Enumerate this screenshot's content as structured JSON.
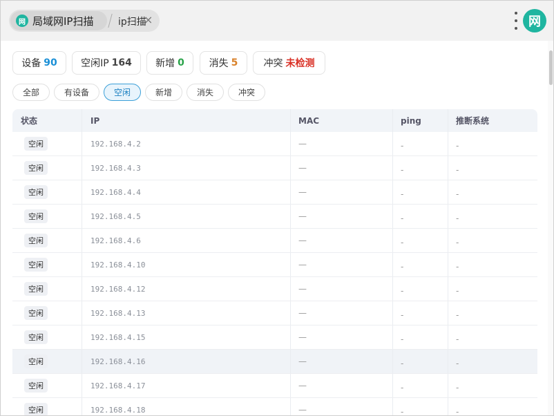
{
  "tabbar": {
    "app_logo_glyph": "网",
    "app_title": "局域网IP扫描",
    "page_tab": "ip扫描",
    "close_glyph": "×"
  },
  "avatar_glyph": "网",
  "stats": [
    {
      "label": "设备",
      "value": "90",
      "color": "#1a8fd6"
    },
    {
      "label": "空闲IP",
      "value": "164",
      "color": "#444444"
    },
    {
      "label": "新增",
      "value": "0",
      "color": "#2aa34a"
    },
    {
      "label": "消失",
      "value": "5",
      "color": "#d9822b"
    },
    {
      "label": "冲突",
      "value": "未检测",
      "color": "#d93025"
    }
  ],
  "filters": [
    {
      "label": "全部",
      "active": false
    },
    {
      "label": "有设备",
      "active": false
    },
    {
      "label": "空闲",
      "active": true
    },
    {
      "label": "新增",
      "active": false
    },
    {
      "label": "消失",
      "active": false
    },
    {
      "label": "冲突",
      "active": false
    }
  ],
  "table": {
    "columns": [
      "状态",
      "IP",
      "MAC",
      "ping",
      "推断系统"
    ],
    "rows": [
      {
        "status": "空闲",
        "ip": "192.168.4.2",
        "mac": "—",
        "ping": "-",
        "os": "-"
      },
      {
        "status": "空闲",
        "ip": "192.168.4.3",
        "mac": "—",
        "ping": "-",
        "os": "-"
      },
      {
        "status": "空闲",
        "ip": "192.168.4.4",
        "mac": "—",
        "ping": "-",
        "os": "-"
      },
      {
        "status": "空闲",
        "ip": "192.168.4.5",
        "mac": "—",
        "ping": "-",
        "os": "-"
      },
      {
        "status": "空闲",
        "ip": "192.168.4.6",
        "mac": "—",
        "ping": "-",
        "os": "-"
      },
      {
        "status": "空闲",
        "ip": "192.168.4.10",
        "mac": "—",
        "ping": "-",
        "os": "-"
      },
      {
        "status": "空闲",
        "ip": "192.168.4.12",
        "mac": "—",
        "ping": "-",
        "os": "-"
      },
      {
        "status": "空闲",
        "ip": "192.168.4.13",
        "mac": "—",
        "ping": "-",
        "os": "-"
      },
      {
        "status": "空闲",
        "ip": "192.168.4.15",
        "mac": "—",
        "ping": "-",
        "os": "-"
      },
      {
        "status": "空闲",
        "ip": "192.168.4.16",
        "mac": "—",
        "ping": "-",
        "os": "-",
        "highlighted": true
      },
      {
        "status": "空闲",
        "ip": "192.168.4.17",
        "mac": "—",
        "ping": "-",
        "os": "-"
      },
      {
        "status": "空闲",
        "ip": "192.168.4.18",
        "mac": "—",
        "ping": "-",
        "os": "-"
      }
    ]
  },
  "colors": {
    "brand": "#1fb5a0",
    "active_filter": "#3a9fd8"
  }
}
